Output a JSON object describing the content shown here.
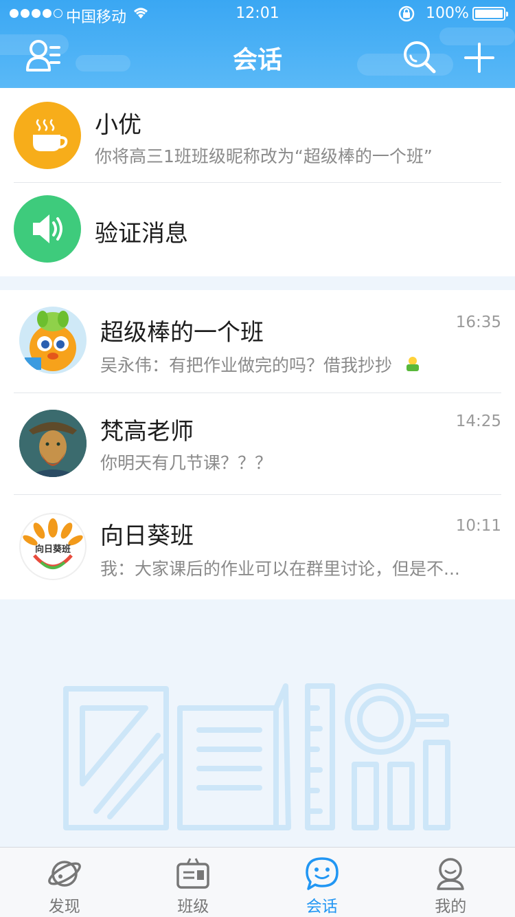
{
  "status_bar": {
    "carrier": "中国移动",
    "time": "12:01",
    "battery": "100%"
  },
  "header": {
    "title": "会话",
    "icons": [
      "contacts-icon",
      "search-icon",
      "plus-icon"
    ]
  },
  "system_items": [
    {
      "name": "小优",
      "message": "你将高三1班班级昵称改为“超级棒的一个班”",
      "icon": "coffee-cup-icon",
      "color": "#f7ad1a"
    },
    {
      "name": "验证消息",
      "icon": "speaker-icon",
      "color": "#3ecb7c"
    }
  ],
  "conversations": [
    {
      "name": "超级棒的一个班",
      "message": "吴永伟：有把作业做完的吗？借我抄抄",
      "time": "16:35"
    },
    {
      "name": "梵高老师",
      "message": "你明天有几节课？？？",
      "time": "14:25"
    },
    {
      "name": "向日葵班",
      "message": "我：大家课后的作业可以在群里讨论，但是不...",
      "time": "10:11",
      "avatar_text": "向日葵班"
    }
  ],
  "tabs": [
    {
      "label": "发现",
      "icon": "planet-icon",
      "active": false
    },
    {
      "label": "班级",
      "icon": "class-board-icon",
      "active": false
    },
    {
      "label": "会话",
      "icon": "chat-bubble-icon",
      "active": true
    },
    {
      "label": "我的",
      "icon": "profile-icon",
      "active": false
    }
  ],
  "colors": {
    "header": "#3aa7f3",
    "accent": "#2196f3",
    "background": "#eef5fc"
  }
}
